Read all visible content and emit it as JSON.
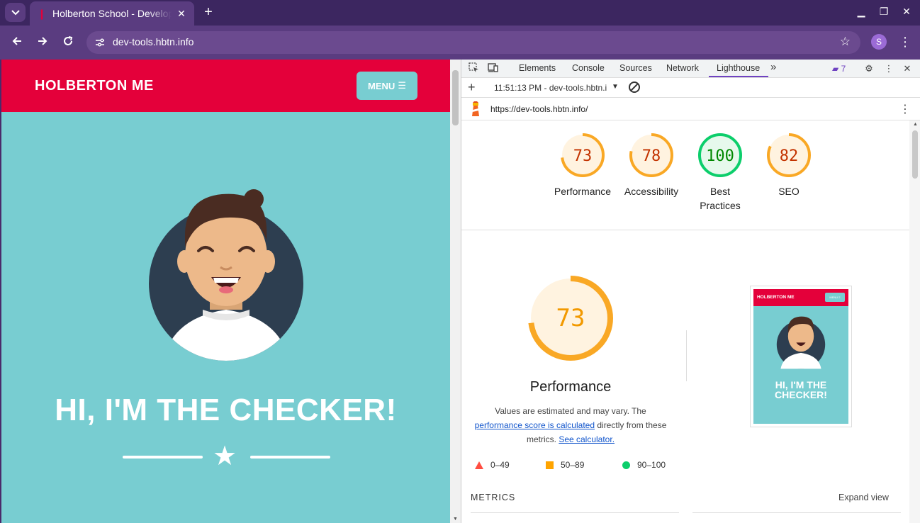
{
  "browser": {
    "tab_title": "Holberton School - Developer Tools",
    "new_tab_label": "+",
    "address_url": "dev-tools.hbtn.info",
    "profile_initial": "S",
    "minimize_glyph": "▁",
    "restore_glyph": "❐",
    "close_glyph": "✕"
  },
  "page": {
    "brand": "HOLBERTON ME",
    "menu_label": "MENU",
    "hero_title": "HI, I'M THE CHECKER!"
  },
  "devtools": {
    "tabs": [
      "Elements",
      "Console",
      "Sources",
      "Network",
      "Lighthouse"
    ],
    "active_tab": "Lighthouse",
    "more_tabs": "»",
    "issues_count": "7",
    "report_selector": "11:51:13 PM - dev-tools.hbtn.i",
    "report_url": "https://dev-tools.hbtn.info/"
  },
  "lighthouse": {
    "scores": [
      {
        "label": "Performance",
        "value": 73,
        "color": "#f9a825",
        "text_color": "#c33300",
        "bg": "#fff3e0"
      },
      {
        "label": "Accessibility",
        "value": 78,
        "color": "#f9a825",
        "text_color": "#c33300",
        "bg": "#fff3e0"
      },
      {
        "label": "Best Practices",
        "value": 100,
        "color": "#0cce6b",
        "text_color": "#008800",
        "bg": "#e6f9ec"
      },
      {
        "label": "SEO",
        "value": 82,
        "color": "#f9a825",
        "text_color": "#c33300",
        "bg": "#fff3e0"
      }
    ],
    "main_score": 73,
    "main_label": "Performance",
    "desc_before": "Values are estimated and may vary. The ",
    "desc_link": "performance score is calculated",
    "desc_middle": " directly from these metrics. ",
    "desc_link2": "See calculator.",
    "legend": [
      {
        "range": "0–49",
        "shape": "triangle",
        "color": "#ff4e42"
      },
      {
        "range": "50–89",
        "shape": "square",
        "color": "#ffa400"
      },
      {
        "range": "90–100",
        "shape": "circle",
        "color": "#0cce6b"
      }
    ],
    "thumb_brand": "HOLBERTON ME",
    "thumb_menu": "MENU ≡",
    "thumb_title": "HI, I'M THE CHECKER!",
    "metrics_label": "METRICS",
    "expand_label": "Expand view"
  }
}
